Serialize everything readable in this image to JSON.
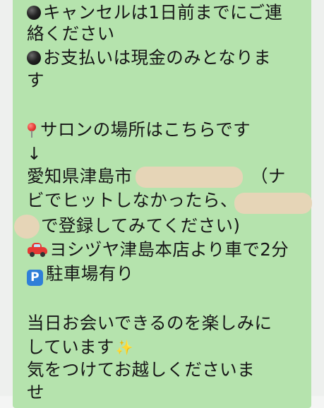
{
  "message": {
    "line1_text": "キャンセルは1日前までにご連",
    "line2_text": "絡ください",
    "line3_text": "お支払いは現金のみとなりま",
    "line4_text": "す",
    "line6_text": "サロンの場所はこちらです",
    "line7_text": "↓",
    "line8_prefix": "愛知県津島市",
    "line8_suffix": "（ナ",
    "line9_text": "ビでヒットしなかったら、",
    "line10_text": "で登録してみてください)",
    "line11_text": "ヨシヅヤ津島本店より車で2分",
    "line12_badge": "P",
    "line12_text": "駐車場有り",
    "line14_text": "当日お会いできるのを楽しみに",
    "line15_text": "しています",
    "line16_text": "気をつけてお越しくださいま",
    "line17_text": "せ"
  },
  "icons": {
    "bullet": "black-circle-icon",
    "pin": "round-pushpin-icon",
    "car": "car-icon",
    "parking": "parking-icon",
    "sparkle": "sparkles-icon"
  },
  "colors": {
    "bubble": "#b5e3ad",
    "background": "#f4f5f4",
    "redaction": "#e6d5b7"
  }
}
